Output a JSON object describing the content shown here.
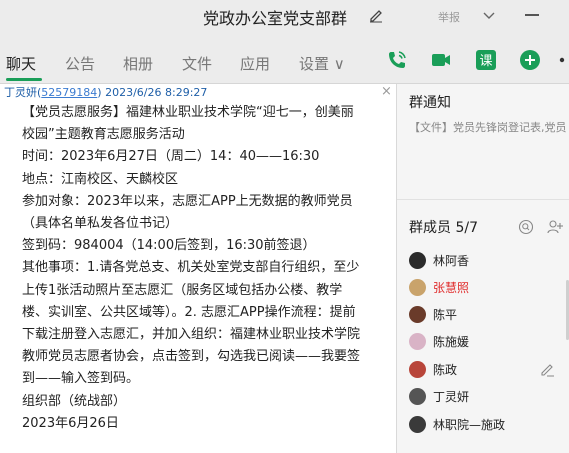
{
  "window": {
    "title": "党政办公室党支部群",
    "report_label": "举报"
  },
  "tabs": [
    {
      "label": "聊天"
    },
    {
      "label": "公告"
    },
    {
      "label": "相册"
    },
    {
      "label": "文件"
    },
    {
      "label": "应用"
    },
    {
      "label": "设置 ∨"
    }
  ],
  "toolbar": {
    "course_label": "课",
    "colors": {
      "accent": "#1a9e58"
    }
  },
  "message": {
    "sender": "丁灵妍",
    "sender_id": "52579184",
    "timestamp": "2023/6/26 8:29:27",
    "close_glyph": "×",
    "lines": [
      "【党员志愿服务】福建林业职业技术学院“迎七一，创美丽",
      "校园”主题教育志愿服务活动",
      "时间：2023年6月27日（周二）14：40——16:30",
      "地点：江南校区、天麟校区",
      "参加对象：2023年以来，志愿汇APP上无数据的教师党员",
      "（具体名单私发各位书记）",
      "签到码：984004（14:00后签到，16:30前签退）",
      "其他事项：1.请各党总支、机关处室党支部自行组织，至少",
      "上传1张活动照片至志愿汇（服务区域包括办公楼、教学",
      "楼、实训室、公共区域等）。2. 志愿汇APP操作流程：提前",
      "下载注册登入志愿汇，并加入组织：福建林业职业技术学院",
      "教师党员志愿者协会，点击签到，勾选我已阅读——我要签",
      "到——输入签到码。",
      "组织部（统战部）",
      "2023年6月26日"
    ]
  },
  "notice": {
    "title": "群通知",
    "text": "【文件】党员先锋岗登记表,党员"
  },
  "members": {
    "title": "群成员 5/7",
    "list": [
      {
        "name": "林阿香",
        "color": "#2b2b2b",
        "highlight": false
      },
      {
        "name": "张慧照",
        "color": "#c9a36b",
        "highlight": true
      },
      {
        "name": "陈平",
        "color": "#6a3b2a",
        "highlight": false
      },
      {
        "name": "陈施媛",
        "color": "#d9b3c6",
        "highlight": false
      },
      {
        "name": "陈政",
        "color": "#b8453a",
        "highlight": false
      },
      {
        "name": "丁灵妍",
        "color": "#555555",
        "highlight": false
      },
      {
        "name": "林职院—施政",
        "color": "#3a3a3a",
        "highlight": false
      }
    ]
  }
}
